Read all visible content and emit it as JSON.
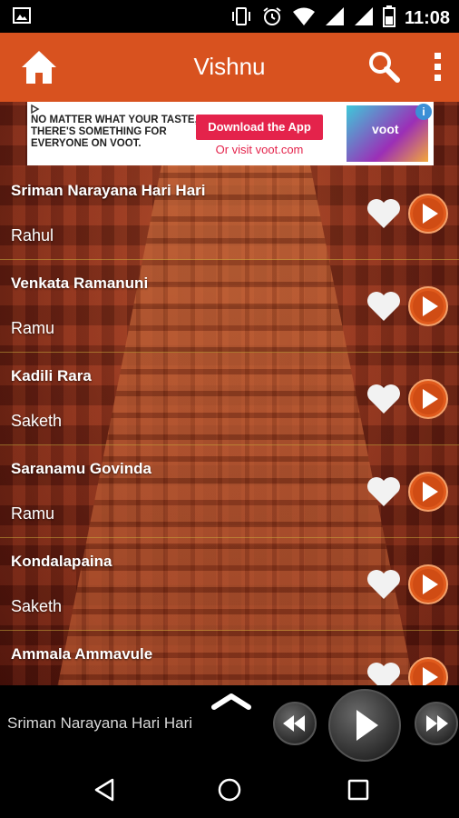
{
  "status_bar": {
    "time": "11:08"
  },
  "app_bar": {
    "title": "Vishnu",
    "accent_color": "#d8521f"
  },
  "ad": {
    "headline": "NO MATTER WHAT YOUR TASTE, THERE'S SOMETHING FOR EVERYONE ON VOOT.",
    "cta_button": "Download the App",
    "cta_link": "Or visit voot.com",
    "logo_text": "voot",
    "info_icon": "i"
  },
  "songs": [
    {
      "title": "Sriman Narayana Hari Hari",
      "artist": "Rahul"
    },
    {
      "title": "Venkata Ramanuni",
      "artist": "Ramu"
    },
    {
      "title": "Kadili Rara",
      "artist": "Saketh"
    },
    {
      "title": "Saranamu Govinda",
      "artist": "Ramu"
    },
    {
      "title": "Kondalapaina",
      "artist": "Saketh"
    },
    {
      "title": "Ammala Ammavule",
      "artist": ""
    }
  ],
  "player": {
    "now_playing": "Sriman Narayana Hari Hari"
  }
}
